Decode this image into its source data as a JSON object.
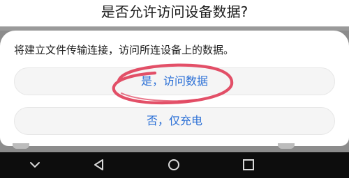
{
  "dialog": {
    "title": "是否允许访问设备数据?",
    "message": "将建立文件传输连接，访问所连设备上的数据。",
    "allow_button": "是，访问数据",
    "deny_button": "否，仅充电"
  },
  "navbar": {
    "icons": [
      "chevron-down-icon",
      "back-icon",
      "home-icon",
      "recents-icon"
    ]
  },
  "colors": {
    "button_text": "#2a6fd6",
    "annotation": "#e03d58",
    "navbar_bg": "#0d0d0d"
  }
}
